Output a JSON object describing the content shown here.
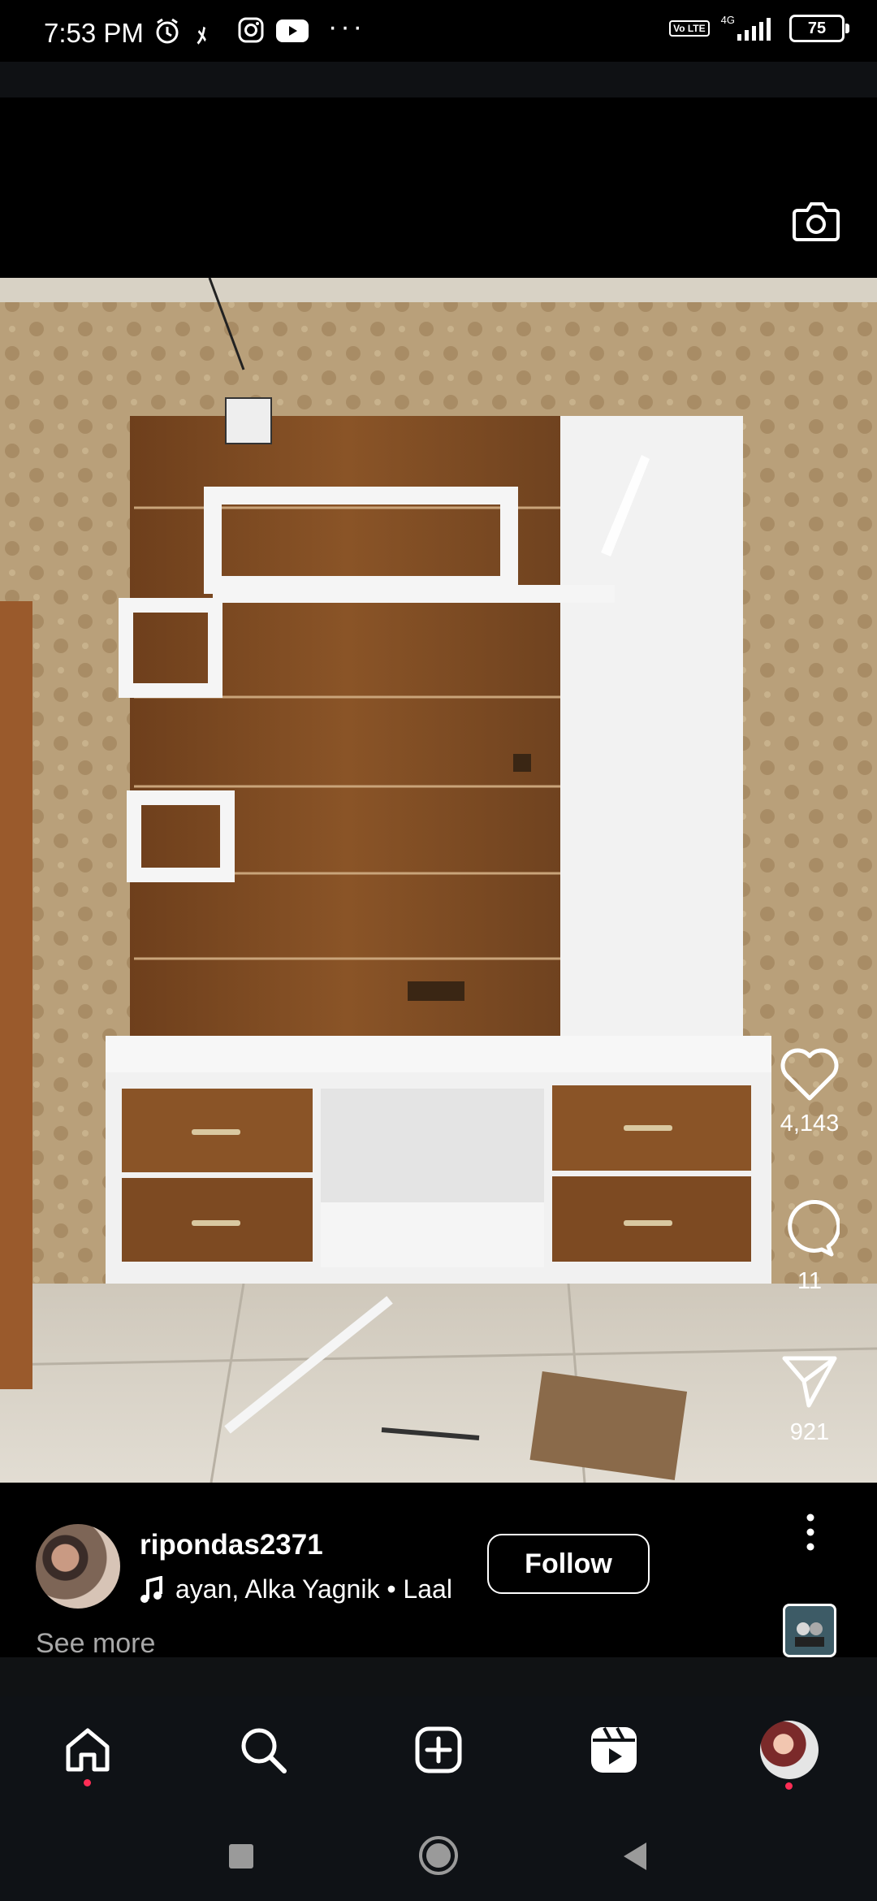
{
  "status_bar": {
    "time": "7:53 PM",
    "network": "4G",
    "volte": "Vo LTE",
    "battery": "75"
  },
  "post": {
    "likes": "4,143",
    "comments": "11",
    "shares": "921",
    "username": "ripondas2371",
    "audio": "ayan, Alka Yagnik • Laal",
    "follow_label": "Follow",
    "see_more": "See more"
  },
  "colors": {
    "background": "#000000",
    "notification_dot": "#ff2d55"
  },
  "icons": [
    "camera-icon",
    "heart-icon",
    "comment-icon",
    "share-icon",
    "more-icon",
    "music-note-icon",
    "home-icon",
    "search-icon",
    "create-icon",
    "reels-icon",
    "profile-avatar",
    "recents-icon",
    "home-circle-icon",
    "back-icon"
  ]
}
